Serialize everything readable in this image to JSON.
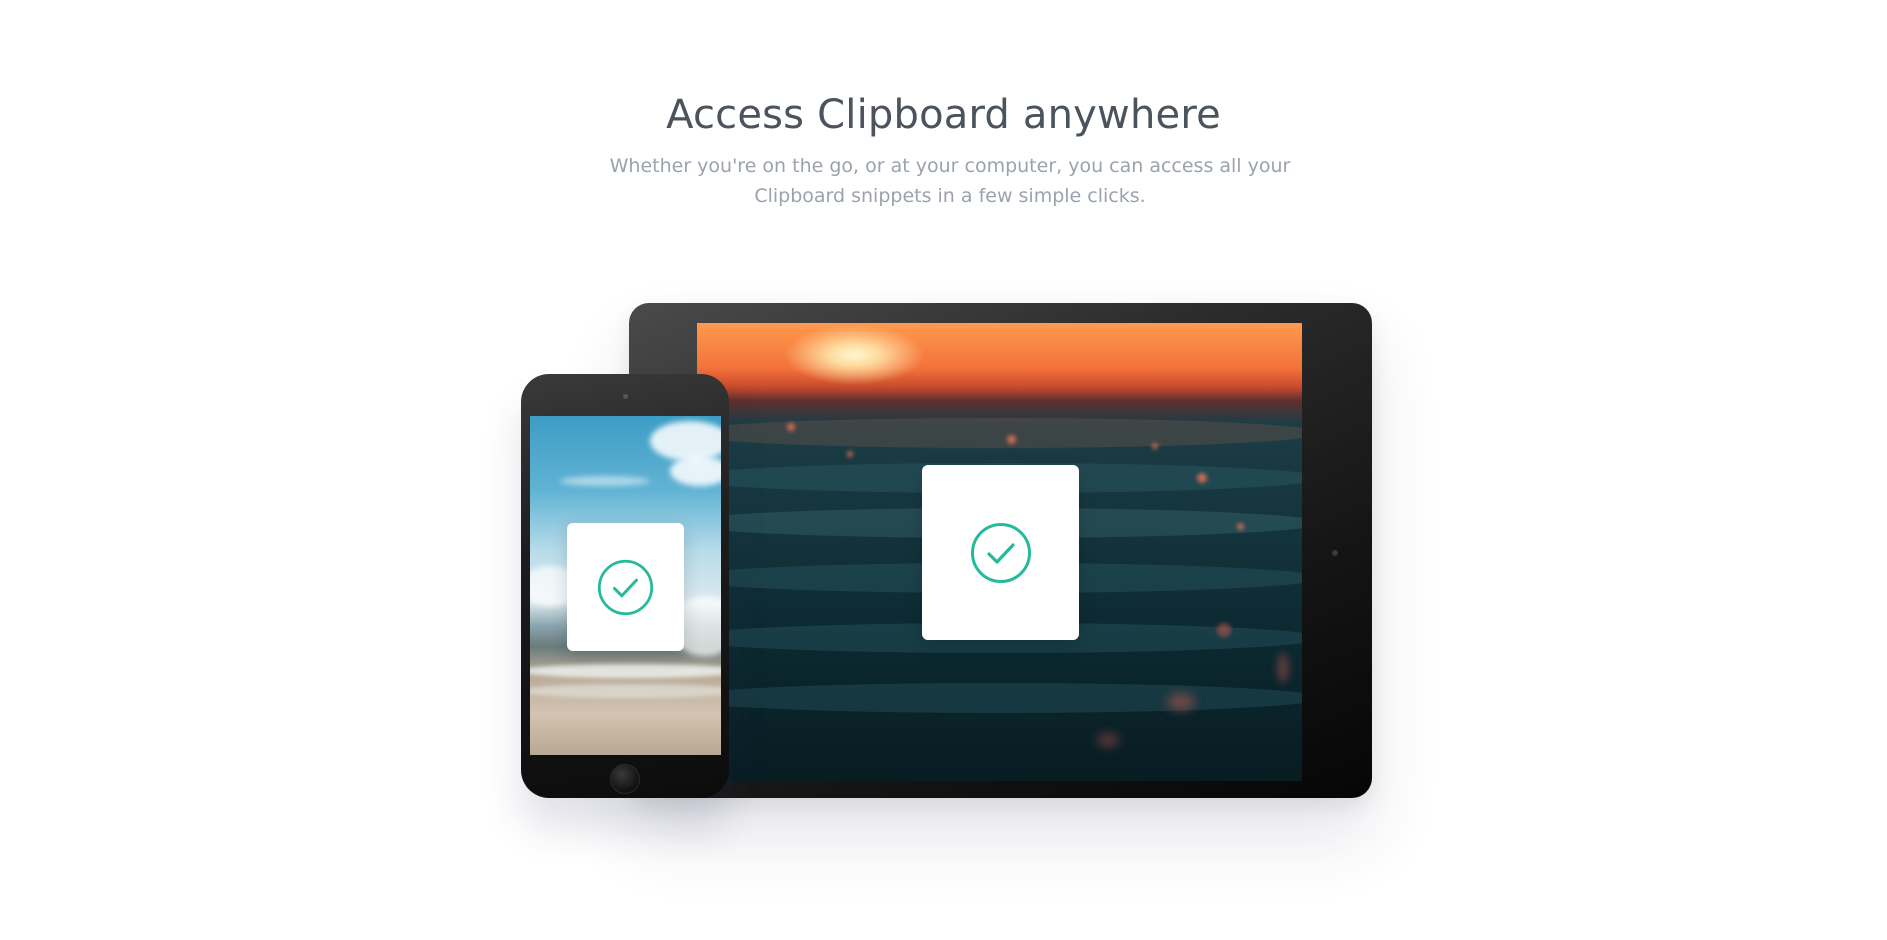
{
  "section": {
    "heading": "Access Clipboard anywhere",
    "description": "Whether you're on the go, or at your computer, you can access all your Clipboard snippets in a few simple clicks."
  },
  "illustration": {
    "tablet_screen": "ocean-sunset-photo",
    "phone_screen": "beach-sky-photo",
    "status_icon": "check-circle-icon"
  },
  "colors": {
    "heading": "#4b535d",
    "description": "#9ba2ad",
    "check_accent": "#26ba9a",
    "background": "#ffffff"
  }
}
